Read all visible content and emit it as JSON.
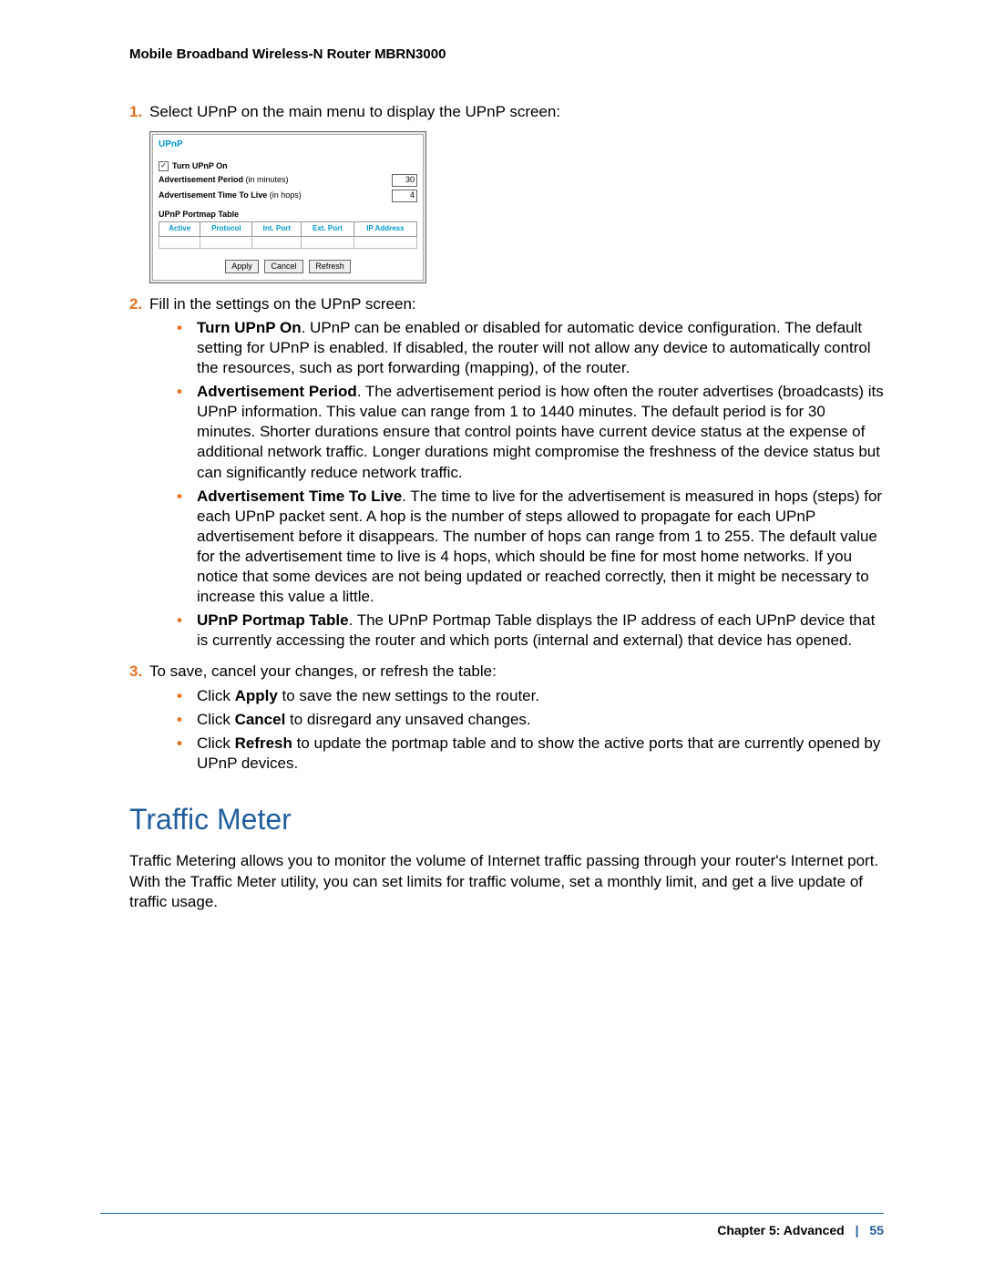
{
  "header": {
    "title": "Mobile Broadband Wireless-N Router MBRN3000"
  },
  "steps": {
    "s1": {
      "num": "1.",
      "text": "Select UPnP on the main menu to display the UPnP screen:"
    },
    "s2": {
      "num": "2.",
      "text": "Fill in the settings on the UPnP screen:",
      "b1": {
        "title": "Turn UPnP On",
        "text": ". UPnP can be enabled or disabled for automatic device configuration. The default setting for UPnP is enabled. If disabled, the router will not allow any device to automatically control the resources, such as port forwarding (mapping), of the router."
      },
      "b2": {
        "title": "Advertisement Period",
        "text": ". The advertisement period is how often the router advertises (broadcasts) its UPnP information. This value can range from 1 to 1440 minutes. The default period is for 30 minutes. Shorter durations ensure that control points have current device status at the expense of additional network traffic. Longer durations might compromise the freshness of the device status but can significantly reduce network traffic."
      },
      "b3": {
        "title": "Advertisement Time To Live",
        "text": ". The time to live for the advertisement is measured in hops (steps) for each UPnP packet sent. A hop is the number of steps allowed to propagate for each UPnP advertisement before it disappears. The number of hops can range from 1 to 255. The default value for the advertisement time to live is 4 hops, which should be fine for most home networks. If you notice that some devices are not being updated or reached correctly, then it might be necessary to increase this value a little."
      },
      "b4": {
        "title": "UPnP Portmap Table",
        "text": ". The UPnP Portmap Table displays the IP address of each UPnP device that is currently accessing the router and which ports (internal and external) that device has opened."
      }
    },
    "s3": {
      "num": "3.",
      "text": "To save, cancel your changes, or refresh the table:",
      "b1": {
        "pre": "Click ",
        "strong": "Apply",
        "post": " to save the new settings to the router."
      },
      "b2": {
        "pre": "Click ",
        "strong": "Cancel",
        "post": " to disregard any unsaved changes."
      },
      "b3": {
        "pre": "Click ",
        "strong": "Refresh",
        "post": " to update the portmap table and to show the active ports that are currently opened by UPnP devices."
      }
    }
  },
  "screenshot": {
    "title": "UPnP",
    "turn_on": "Turn UPnP On",
    "adv_period_label": "Advertisement Period",
    "adv_period_unit": " (in minutes)",
    "adv_period_val": "30",
    "ttl_label": "Advertisement Time To Live",
    "ttl_unit": " (in hops)",
    "ttl_val": "4",
    "portmap_title": "UPnP Portmap Table",
    "cols": {
      "c0": "Active",
      "c1": "Protocol",
      "c2": "Int. Port",
      "c3": "Ext. Port",
      "c4": "IP Address"
    },
    "btn_apply": "Apply",
    "btn_cancel": "Cancel",
    "btn_refresh": "Refresh"
  },
  "section": {
    "title": "Traffic Meter",
    "para": "Traffic Metering allows you to monitor the volume of Internet traffic passing through your router's Internet port. With the Traffic Meter utility, you can set limits for traffic volume, set a monthly limit, and get a live update of traffic usage."
  },
  "footer": {
    "chapter": "Chapter 5:  Advanced",
    "sep": "|",
    "page": "55"
  }
}
